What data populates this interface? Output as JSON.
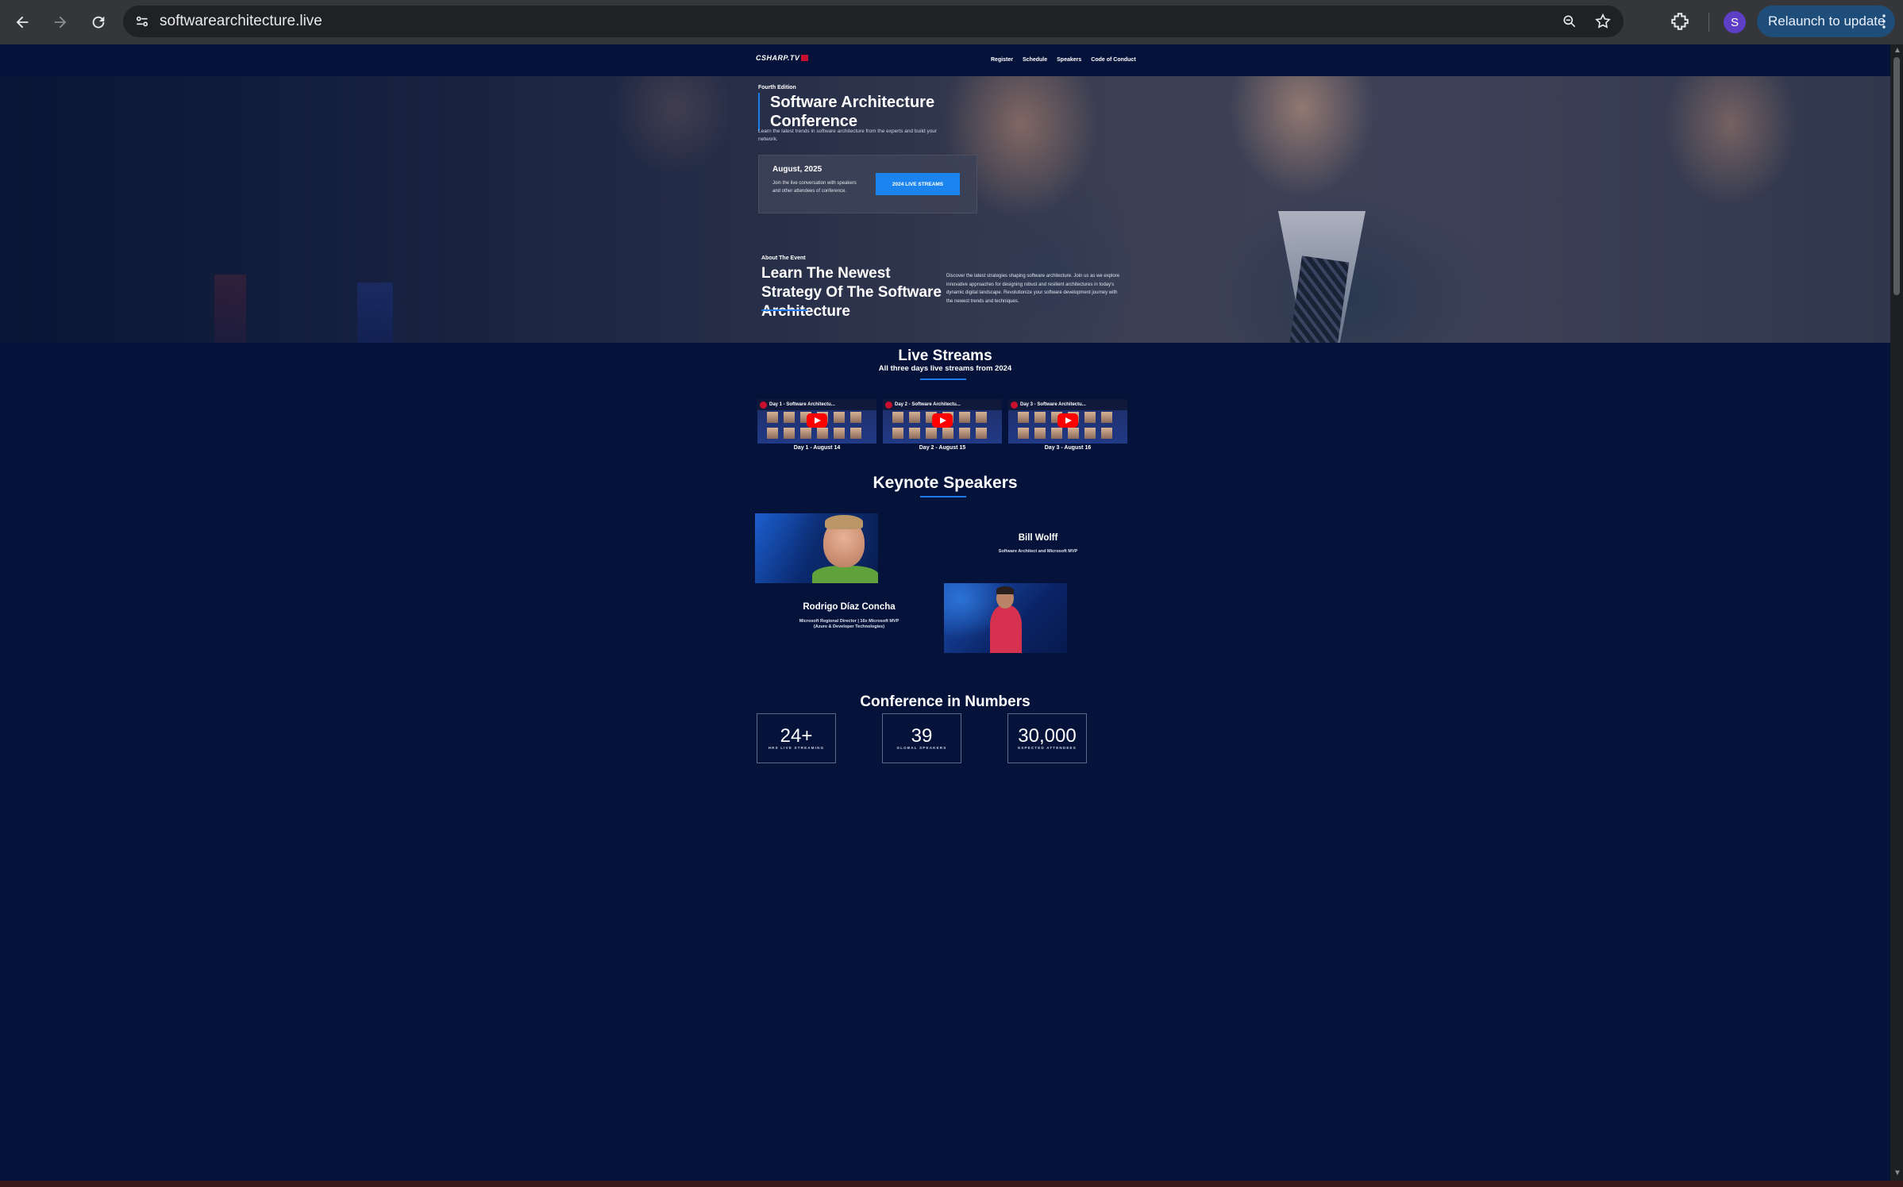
{
  "browser": {
    "url": "softwarearchitecture.live",
    "relaunch_label": "Relaunch to update",
    "profile_initial": "S"
  },
  "site": {
    "logo": "CSHARP.TV",
    "nav": [
      "Register",
      "Schedule",
      "Speakers",
      "Code of Conduct"
    ]
  },
  "hero": {
    "edition": "Fourth Edition",
    "title": "Software Architecture Conference",
    "text": "Learn the latest trends in software architecture from the experts and build your network.",
    "card": {
      "date": "August, 2025",
      "description": "Join the live conversation with speakers and other attendees of conference.",
      "button": "2024 LIVE STREAMS"
    }
  },
  "about": {
    "eyebrow": "About The Event",
    "title": "Learn The Newest Strategy Of The Software Architecture",
    "text": "Discover the latest strategies shaping software architecture. Join us as we explore innovative approaches for designing robust and resilient architectures in today's dynamic digital landscape. Revolutionize your software development journey with the newest trends and techniques."
  },
  "live_streams": {
    "title": "Live Streams",
    "subtitle": "All three days live streams from 2024",
    "videos": [
      {
        "video_title": "Day 1 - Software Architectu...",
        "label": "Day 1 - August 14"
      },
      {
        "video_title": "Day 2 - Software Architectu...",
        "label": "Day 2 - August 15"
      },
      {
        "video_title": "Day 3 - Software Architectu...",
        "label": "Day 3 - August 16"
      }
    ]
  },
  "keynote": {
    "title": "Keynote Speakers",
    "speakers": [
      {
        "name": "Bill Wolff",
        "role": "Software Architect and Microsoft MVP"
      },
      {
        "name": "Rodrigo Díaz Concha",
        "role": "Microsoft Regional Director | 16x Microsoft MVP (Azure & Developer Technologies)"
      }
    ]
  },
  "numbers": {
    "title": "Conference in Numbers",
    "stats": [
      {
        "value": "24+",
        "label": "HRS LIVE STREAMING"
      },
      {
        "value": "39",
        "label": "GLOBAL SPEAKERS"
      },
      {
        "value": "30,000",
        "label": "EXPECTED ATTENDEES"
      }
    ]
  },
  "colors": {
    "page_bg": "#05133a",
    "accent": "#1b84ee",
    "chrome_bg": "#35363a"
  }
}
